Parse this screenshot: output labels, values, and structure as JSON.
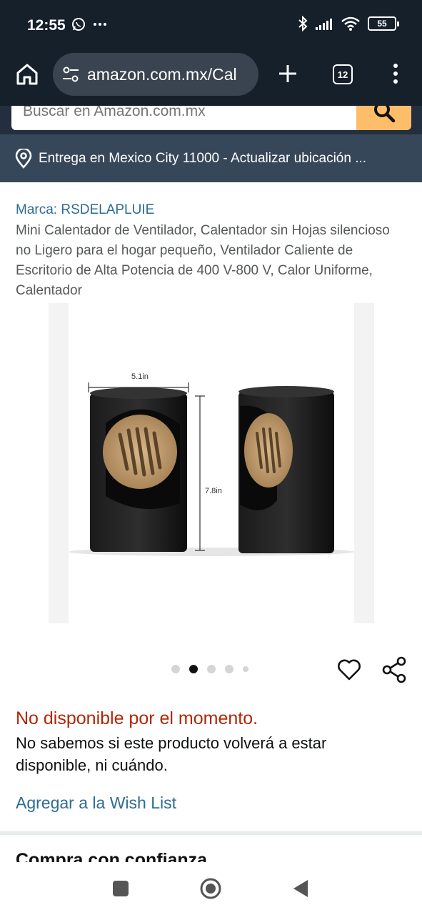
{
  "status_bar": {
    "time": "12:55",
    "battery": "55",
    "icons": [
      "whatsapp-icon",
      "more-dots-icon",
      "bluetooth-icon",
      "signal-icon",
      "wifi-icon",
      "battery-icon"
    ]
  },
  "browser": {
    "url": "amazon.com.mx/Cal",
    "tab_count": "12",
    "icons": [
      "home-icon",
      "site-settings-icon",
      "plus-icon",
      "tabs-icon",
      "menu-dots-icon"
    ]
  },
  "search": {
    "placeholder": "Buscar en Amazon.com.mx"
  },
  "delivery": {
    "text": "Entrega en Mexico City 11000 - Actualizar ubicación ..."
  },
  "product": {
    "brand": "Marca: RSDELAPLUIE",
    "title": "Mini Calentador de Ventilador, Calentador sin Hojas silencioso no Ligero para el hogar pequeño, Ventilador Caliente de Escritorio de Alta Potencia de 400 V-800 V, Calor Uniforme, Calentador",
    "image_labels": {
      "width": "5.1in",
      "height": "7.8in"
    },
    "carousel": {
      "total": 5,
      "active_index": 1
    }
  },
  "availability": {
    "status": "No disponible por el momento.",
    "message": "No sabemos si este producto volverá a estar disponible, ni cuándo.",
    "status_color": "#b12704"
  },
  "actions": {
    "wishlist": "Agregar a la Wish List"
  },
  "section": {
    "heading": "Compra con confianza"
  },
  "colors": {
    "link": "#2d6b93",
    "search_button": "#febd69",
    "header_dark": "#232f3e",
    "delivery_bar": "#37475a"
  }
}
